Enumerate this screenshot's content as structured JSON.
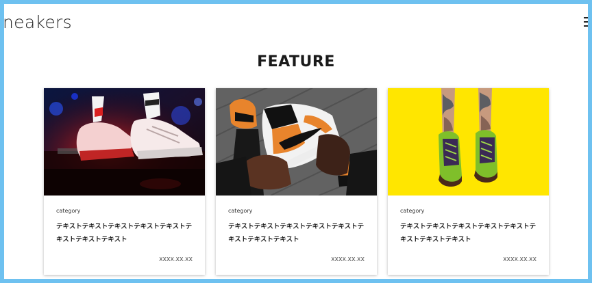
{
  "header": {
    "logo_text": "neakers"
  },
  "section": {
    "title": "FEATURE"
  },
  "cards": [
    {
      "category": "category",
      "text": "テキストテキストテキストテキストテキストテキストテキストテキスト",
      "date": "XXXX.XX.XX",
      "image": "sneakers-dj-stage-photo"
    },
    {
      "category": "category",
      "text": "テキストテキストテキストテキストテキストテキストテキストテキスト",
      "date": "XXXX.XX.XX",
      "image": "hands-holding-orange-sneaker-photo"
    },
    {
      "category": "category",
      "text": "テキストテキストテキストテキストテキストテキストテキストテキスト",
      "date": "XXXX.XX.XX",
      "image": "green-sneakers-yellow-background-photo"
    }
  ],
  "colors": {
    "border": "#6ec1f0",
    "text": "#1a1a1a",
    "accent_yellow": "#ffe600"
  },
  "icons": {
    "menu": "hamburger-menu-icon"
  }
}
